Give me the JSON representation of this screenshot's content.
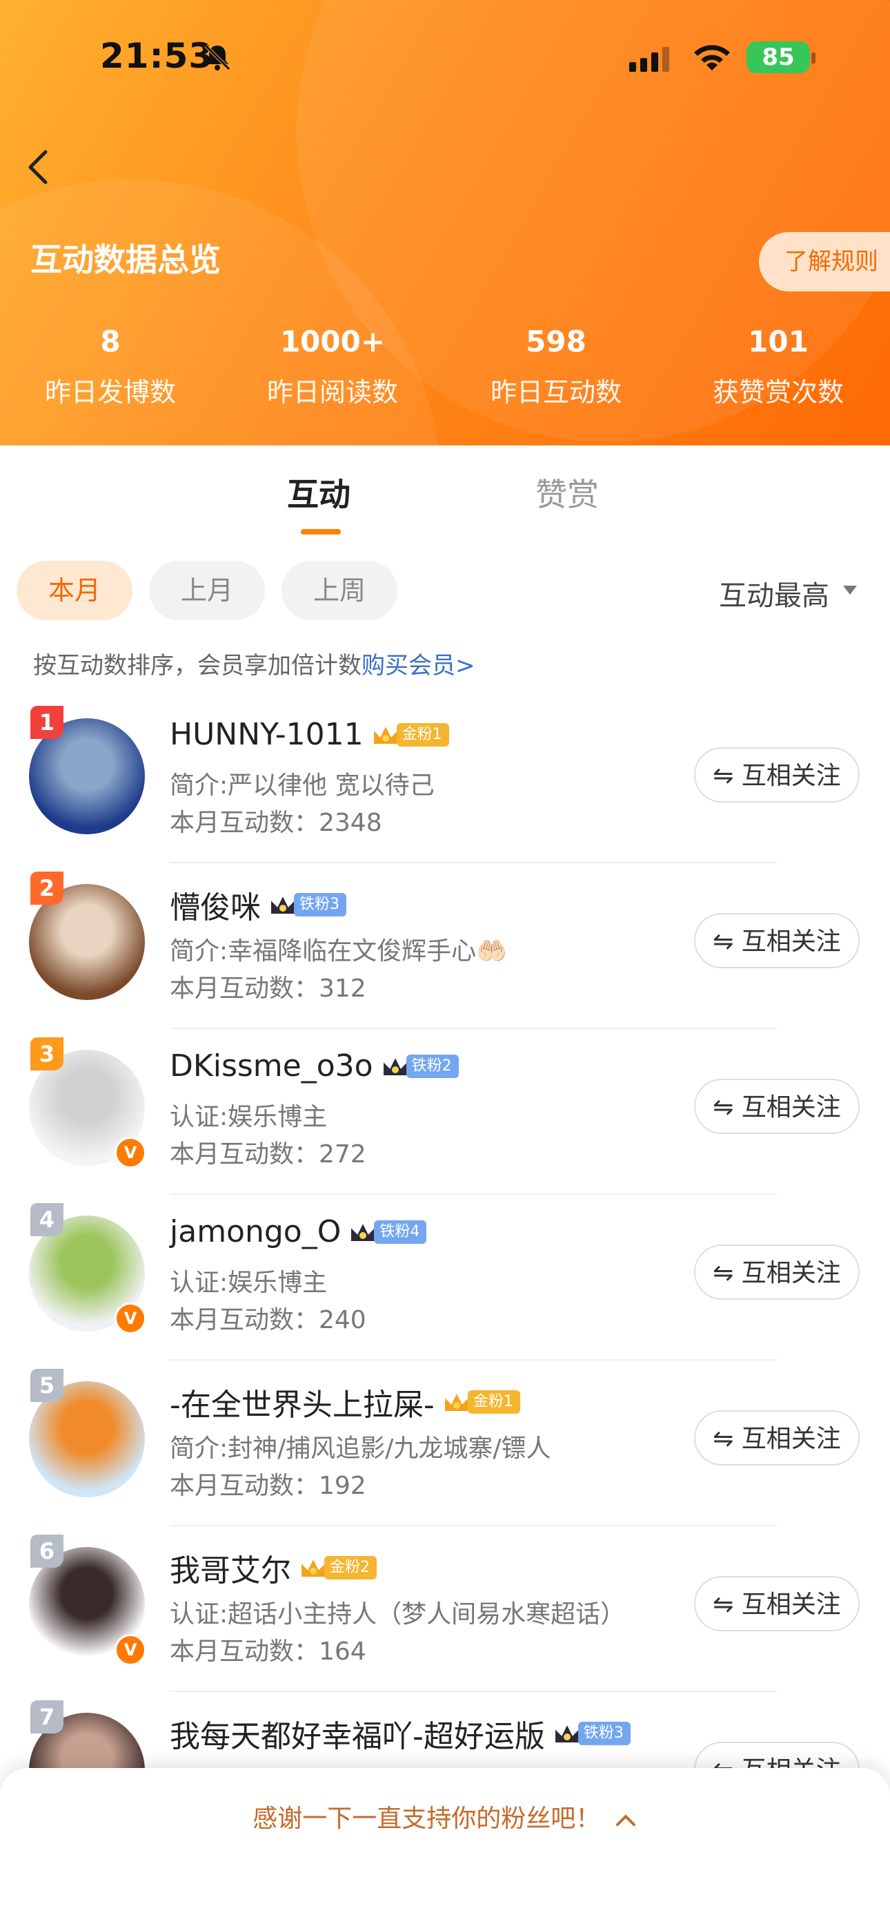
{
  "status_bar": {
    "time": "21:53",
    "battery": "85"
  },
  "header": {
    "title": "互动数据总览",
    "rules_button": "了解规则",
    "stats": [
      {
        "value": "8",
        "label": "昨日发博数"
      },
      {
        "value": "1000+",
        "label": "昨日阅读数"
      },
      {
        "value": "598",
        "label": "昨日互动数"
      },
      {
        "value": "101",
        "label": "获赞赏次数"
      }
    ]
  },
  "tabs": {
    "active": "互动",
    "inactive": "赞赏"
  },
  "filters": {
    "chips": [
      "本月",
      "上月",
      "上周"
    ],
    "sort": "互动最高"
  },
  "hint": {
    "text": "按互动数排序，会员享加倍计数",
    "link": "购买会员>"
  },
  "follow_label": "⇋ 互相关注",
  "users": [
    {
      "rank": "1",
      "name": "HUNNY-1011",
      "fan": "金粉1",
      "fan_type": "gold",
      "bio": "简介:严以律他 宽以待己",
      "count": "本月互动数：2348",
      "verified": false,
      "rank_color": "#f2413b",
      "avatar_colors": [
        "#1e3a8a",
        "#8aa6c8"
      ]
    },
    {
      "rank": "2",
      "name": "懵俊咪",
      "fan": "铁粉3",
      "fan_type": "iron",
      "bio": "简介:幸福降临在文俊辉手心🤲🏻",
      "count": "本月互动数：312",
      "verified": false,
      "rank_color": "#ff6a2a",
      "avatar_colors": [
        "#7a4a2a",
        "#e8d4c0"
      ]
    },
    {
      "rank": "3",
      "name": "DKissme_o3o",
      "fan": "铁粉2",
      "fan_type": "iron",
      "bio": "认证:娱乐博主",
      "count": "本月互动数：272",
      "verified": true,
      "rank_color": "#ff9a1a",
      "avatar_colors": [
        "#f4f4f4",
        "#d0d0d0"
      ]
    },
    {
      "rank": "4",
      "name": "jamongo_O",
      "fan": "铁粉4",
      "fan_type": "iron",
      "bio": "认证:娱乐博主",
      "count": "本月互动数：240",
      "verified": true,
      "rank_color": "#b5bcc8",
      "avatar_colors": [
        "#f2f2f6",
        "#9bc45a"
      ]
    },
    {
      "rank": "5",
      "name": "-在全世界头上拉屎-",
      "fan": "金粉1",
      "fan_type": "gold",
      "bio": "简介:封神/捕风追影/九龙城寨/镖人",
      "count": "本月互动数：192",
      "verified": false,
      "rank_color": "#b5bcc8",
      "avatar_colors": [
        "#cfe6f7",
        "#f08a2a"
      ]
    },
    {
      "rank": "6",
      "name": "我哥艾尔",
      "fan": "金粉2",
      "fan_type": "gold",
      "bio": "认证:超话小主持人（梦人间易水寒超话）",
      "count": "本月互动数：164",
      "verified": true,
      "rank_color": "#b5bcc8",
      "avatar_colors": [
        "#ffffff",
        "#3a2a2a"
      ]
    },
    {
      "rank": "7",
      "name": "我每天都好幸福吖-超好运版",
      "fan": "铁粉3",
      "fan_type": "iron",
      "bio": "",
      "count": "",
      "verified": false,
      "rank_color": "#b5bcc8",
      "avatar_colors": [
        "#3a2a2a",
        "#c8a090"
      ]
    }
  ],
  "bottom_bar": {
    "text": "感谢一下一直支持你的粉丝吧！"
  },
  "colors": {
    "accent": "#ff8200",
    "header_start": "#ffb02e",
    "header_end": "#ff6a05",
    "link": "#3a70c4"
  }
}
